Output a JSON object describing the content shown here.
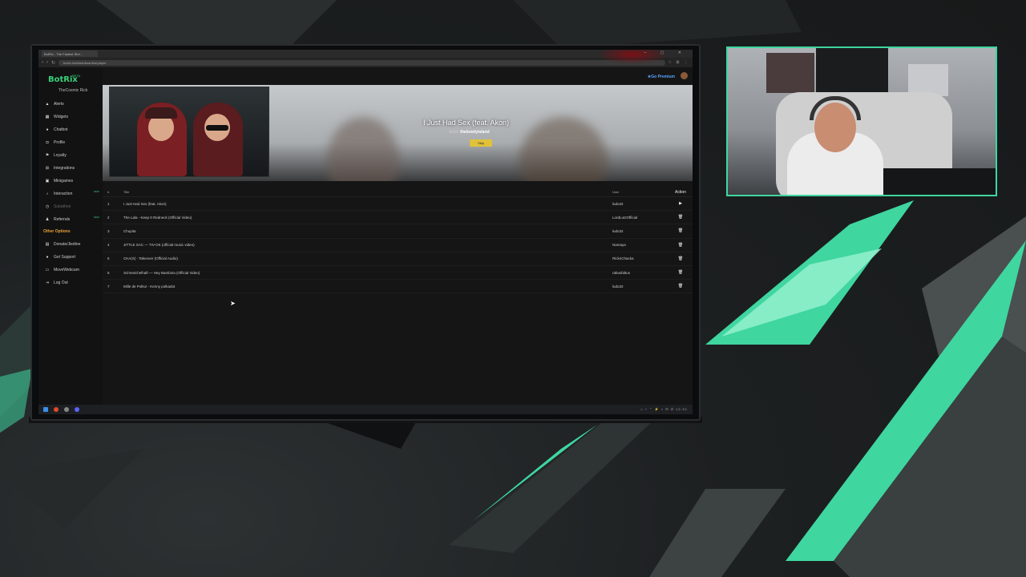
{
  "browser": {
    "tab_title": "BotRix - The Fastest Stre...",
    "url": "botrix.live/dashboard/sr/player",
    "window_controls": "– ▢ ✕"
  },
  "app": {
    "brand": "BotRix",
    "beta_badge": "BETA",
    "account": "TheCosmic Rick",
    "premium_label": "Go Premium",
    "nav": [
      {
        "label": "Alerts",
        "icon": "bell-icon"
      },
      {
        "label": "Widgets",
        "icon": "grid-icon"
      },
      {
        "label": "Chatbot",
        "icon": "bot-icon"
      },
      {
        "label": "Profile",
        "icon": "user-icon"
      },
      {
        "label": "Loyalty",
        "icon": "gift-icon"
      },
      {
        "label": "Integrations",
        "icon": "plug-icon"
      },
      {
        "label": "Minigames",
        "icon": "gamepad-icon"
      },
      {
        "label": "Interaction",
        "icon": "music-icon",
        "badge": "NEW"
      },
      {
        "label": "Subathon",
        "icon": "clock-icon"
      },
      {
        "label": "Referrals",
        "icon": "users-icon",
        "badge": "NEW"
      }
    ],
    "other_section": "Other Options",
    "other": [
      {
        "label": "Donate/Jiedine",
        "icon": "heart-icon"
      },
      {
        "label": "Get Support",
        "icon": "help-icon"
      },
      {
        "label": "MoveWebcam",
        "icon": "window-icon"
      },
      {
        "label": "Log Out",
        "icon": "logout-icon"
      }
    ]
  },
  "now_playing": {
    "title": "I Just Had Sex (feat. Akon)",
    "requested_by_label": "Artist:",
    "artist": "thelonelyisland",
    "skip_label": "Skip"
  },
  "table": {
    "headers": {
      "num": "#",
      "title": "Title",
      "user": "User",
      "action": "Action"
    },
    "rows": [
      {
        "num": "1",
        "title": "I Just Had Sex (feat. Akon)",
        "user": "ludo32",
        "action": "▶"
      },
      {
        "num": "2",
        "title": "The Lala - Keep It Redneck (Official Video)",
        "user": "LordLutzOfficial",
        "action": "🗑"
      },
      {
        "num": "3",
        "title": "Chupita",
        "user": "ludo32",
        "action": "🗑"
      },
      {
        "num": "4",
        "title": "JITTLE SAC — TIV-OK (official music video)",
        "user": "Namaya",
        "action": "🗑"
      },
      {
        "num": "5",
        "title": "CKA(S) - Takeover (Official Audio)",
        "user": "RicknChacka",
        "action": "🗑"
      },
      {
        "num": "6",
        "title": "Schmeichelhaft — Hey Bambina (Official Video)",
        "user": "rabusfaltus",
        "action": "🗑"
      },
      {
        "num": "7",
        "title": "Mille de Polku! - Kenny polkadot",
        "user": "ludo32",
        "action": "🗑"
      }
    ]
  },
  "taskbar": {
    "tray": "⌂ ⌁ ⌃ ⚡ ⌂ ⊡ ⏻ 12:51"
  },
  "colors": {
    "accent_green": "#38d17a",
    "webcam_border": "#3fd6a0",
    "premium_blue": "#58a6ff",
    "skip_yellow": "#e0c23a"
  }
}
